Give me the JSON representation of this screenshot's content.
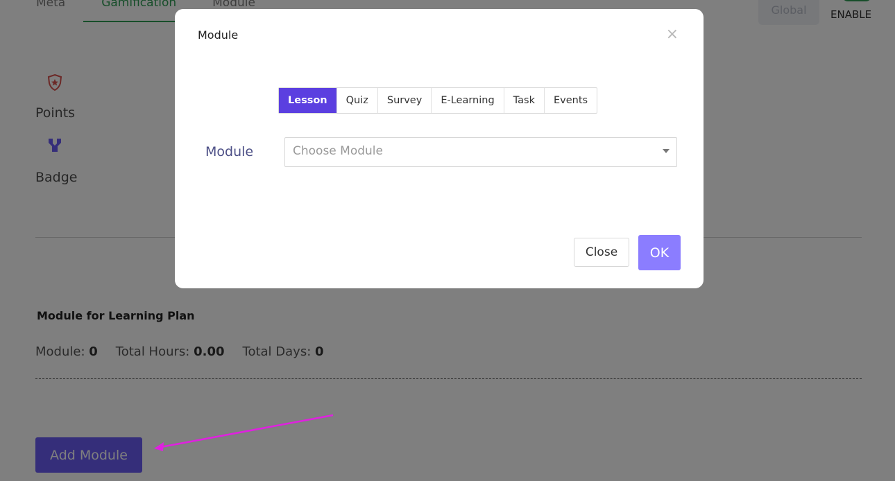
{
  "background": {
    "tabs": [
      "Meta",
      "Gamification",
      "Module"
    ],
    "active_tab": "Gamification",
    "global_label": "Global",
    "enable_label": "ENABLE",
    "gamification": {
      "points_label": "Points",
      "badge_label": "Badge",
      "points_icon": "star-shield-icon",
      "badge_icon": "badge-trophy-icon"
    },
    "section_title": "Module for Learning Plan",
    "stats": {
      "module_label": "Module:",
      "module_value": "0",
      "hours_label": "Total Hours:",
      "hours_value": "0.00",
      "days_label": "Total Days:",
      "days_value": "0"
    },
    "add_module_label": "Add Module"
  },
  "modal": {
    "title": "Module",
    "close_icon": "×",
    "type_tabs": [
      "Lesson",
      "Quiz",
      "Survey",
      "E-Learning",
      "Task",
      "Events"
    ],
    "active_type": "Lesson",
    "field_label": "Module",
    "select_placeholder": "Choose Module",
    "close_label": "Close",
    "ok_label": "OK"
  },
  "colors": {
    "accent": "#6a5cf5",
    "active_segment": "#5b3fe0",
    "ok_button": "#8b7dff",
    "tab_active": "#2e9d55",
    "annotation_arrow": "#e020e0"
  }
}
